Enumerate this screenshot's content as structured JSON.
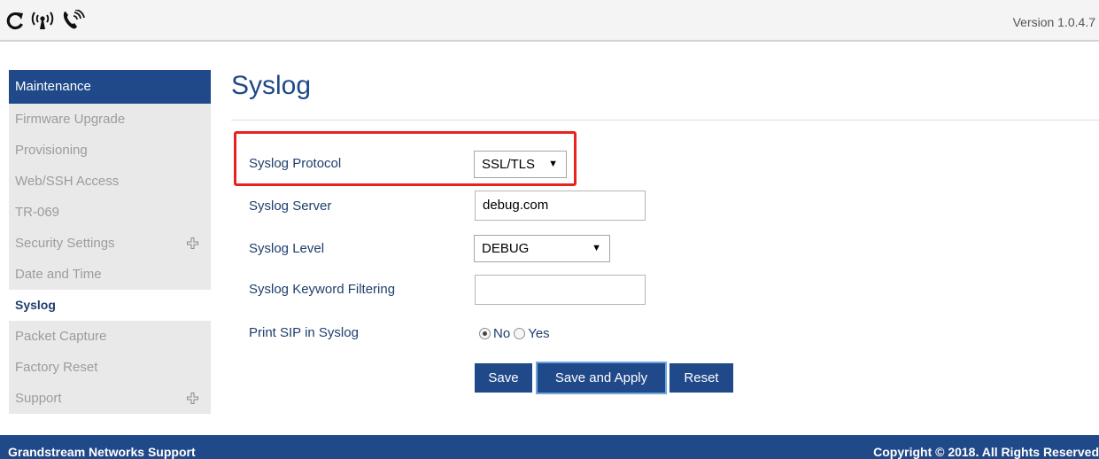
{
  "header": {
    "icons": [
      "refresh-icon",
      "wireless-signal-icon",
      "phone-icon"
    ],
    "version": "Version 1.0.4.7"
  },
  "sidebar": {
    "section_title": "Maintenance",
    "items": [
      {
        "label": "Firmware Upgrade",
        "active": false,
        "expandable": false
      },
      {
        "label": "Provisioning",
        "active": false,
        "expandable": false
      },
      {
        "label": "Web/SSH Access",
        "active": false,
        "expandable": false
      },
      {
        "label": "TR-069",
        "active": false,
        "expandable": false
      },
      {
        "label": "Security Settings",
        "active": false,
        "expandable": true
      },
      {
        "label": "Date and Time",
        "active": false,
        "expandable": false
      },
      {
        "label": "Syslog",
        "active": true,
        "expandable": false
      },
      {
        "label": "Packet Capture",
        "active": false,
        "expandable": false
      },
      {
        "label": "Factory Reset",
        "active": false,
        "expandable": false
      },
      {
        "label": "Support",
        "active": false,
        "expandable": true
      }
    ]
  },
  "main": {
    "title": "Syslog",
    "fields": {
      "protocol": {
        "label": "Syslog Protocol",
        "value": "SSL/TLS"
      },
      "server": {
        "label": "Syslog Server",
        "value": "debug.com"
      },
      "level": {
        "label": "Syslog Level",
        "value": "DEBUG"
      },
      "keyword": {
        "label": "Syslog Keyword Filtering",
        "value": ""
      },
      "print_sip": {
        "label": "Print SIP in Syslog",
        "option_no": "No",
        "option_yes": "Yes",
        "selected": "No"
      }
    },
    "buttons": {
      "save": "Save",
      "save_apply": "Save and Apply",
      "reset": "Reset"
    },
    "highlight_color": "#e8231f"
  },
  "footer": {
    "left": "Grandstream Networks Support",
    "right": "Copyright © 2018. All Rights Reserved"
  },
  "colors": {
    "brand": "#1f4989",
    "text": "#1f3e6c",
    "sidebar_bg": "#e9e9e9"
  }
}
